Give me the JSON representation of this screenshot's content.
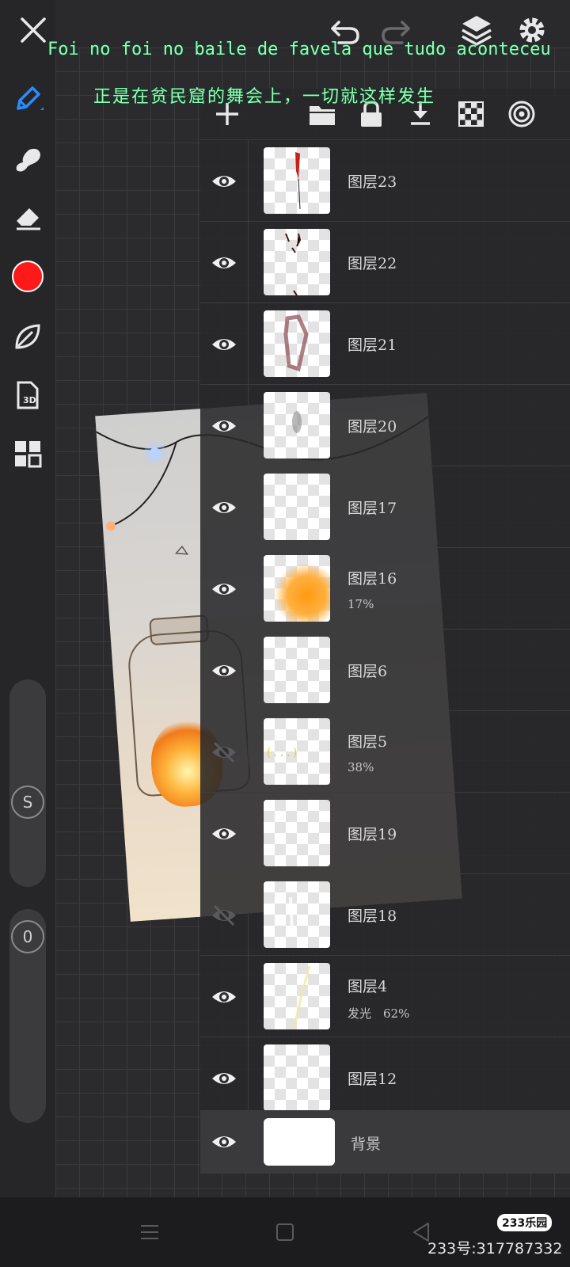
{
  "subtitles": {
    "line1": "Foi no foi no baile de favela que tudo aconteceu",
    "line2": "正是在贫民窟的舞会上，一切就这样发生"
  },
  "toolbar": {
    "icons": [
      "close-icon",
      "undo-icon",
      "redo-icon",
      "layers-icon",
      "settings-icon"
    ]
  },
  "tools": {
    "items": [
      "pen-icon",
      "smudge-icon",
      "eraser-icon",
      "color-swatch",
      "leaf-icon",
      "3d-model-icon",
      "grid-icon"
    ],
    "current_color": "#ff1a1a",
    "size_label": "S",
    "opacity_label": "0"
  },
  "layer_toolbar": {
    "icons": [
      "add-layer-icon",
      "folder-icon",
      "lock-icon",
      "merge-down-icon",
      "transparency-icon",
      "blend-icon"
    ]
  },
  "layers": [
    {
      "name": "图层23",
      "sub": "",
      "visible": true
    },
    {
      "name": "图层22",
      "sub": "",
      "visible": true
    },
    {
      "name": "图层21",
      "sub": "",
      "visible": true
    },
    {
      "name": "图层20",
      "sub": "",
      "visible": true
    },
    {
      "name": "图层17",
      "sub": "",
      "visible": true
    },
    {
      "name": "图层16",
      "sub": "17%",
      "visible": true
    },
    {
      "name": "图层6",
      "sub": "",
      "visible": true
    },
    {
      "name": "图层5",
      "sub": "38%",
      "visible": false
    },
    {
      "name": "图层19",
      "sub": "",
      "visible": true
    },
    {
      "name": "图层18",
      "sub": "",
      "visible": false
    },
    {
      "name": "图层4",
      "sub": "发光　62%",
      "visible": true
    },
    {
      "name": "图层12",
      "sub": "",
      "visible": true
    }
  ],
  "background_layer": {
    "name": "背景",
    "visible": true
  },
  "watermark": {
    "badge": "233乐园",
    "id": "233号:317787332"
  }
}
